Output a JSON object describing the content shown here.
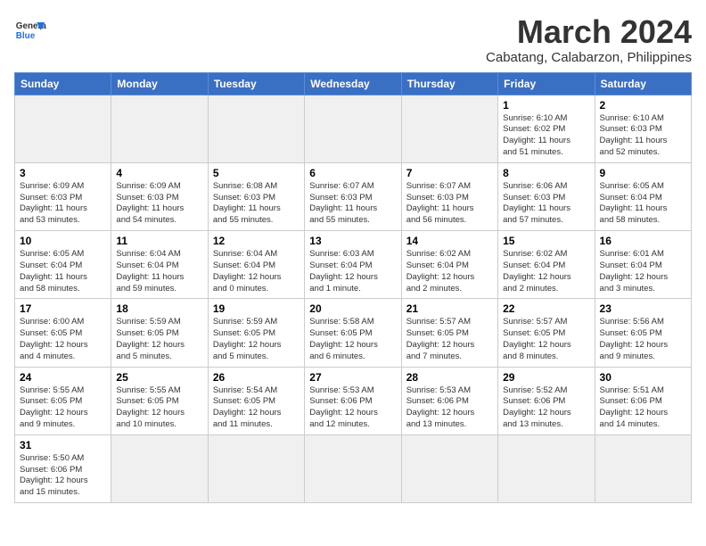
{
  "logo": {
    "general": "General",
    "blue": "Blue"
  },
  "title": "March 2024",
  "subtitle": "Cabatang, Calabarzon, Philippines",
  "days_header": [
    "Sunday",
    "Monday",
    "Tuesday",
    "Wednesday",
    "Thursday",
    "Friday",
    "Saturday"
  ],
  "weeks": [
    [
      {
        "num": "",
        "info": "",
        "empty": true
      },
      {
        "num": "",
        "info": "",
        "empty": true
      },
      {
        "num": "",
        "info": "",
        "empty": true
      },
      {
        "num": "",
        "info": "",
        "empty": true
      },
      {
        "num": "",
        "info": "",
        "empty": true
      },
      {
        "num": "1",
        "info": "Sunrise: 6:10 AM\nSunset: 6:02 PM\nDaylight: 11 hours\nand 51 minutes.",
        "empty": false
      },
      {
        "num": "2",
        "info": "Sunrise: 6:10 AM\nSunset: 6:03 PM\nDaylight: 11 hours\nand 52 minutes.",
        "empty": false
      }
    ],
    [
      {
        "num": "3",
        "info": "Sunrise: 6:09 AM\nSunset: 6:03 PM\nDaylight: 11 hours\nand 53 minutes.",
        "empty": false
      },
      {
        "num": "4",
        "info": "Sunrise: 6:09 AM\nSunset: 6:03 PM\nDaylight: 11 hours\nand 54 minutes.",
        "empty": false
      },
      {
        "num": "5",
        "info": "Sunrise: 6:08 AM\nSunset: 6:03 PM\nDaylight: 11 hours\nand 55 minutes.",
        "empty": false
      },
      {
        "num": "6",
        "info": "Sunrise: 6:07 AM\nSunset: 6:03 PM\nDaylight: 11 hours\nand 55 minutes.",
        "empty": false
      },
      {
        "num": "7",
        "info": "Sunrise: 6:07 AM\nSunset: 6:03 PM\nDaylight: 11 hours\nand 56 minutes.",
        "empty": false
      },
      {
        "num": "8",
        "info": "Sunrise: 6:06 AM\nSunset: 6:03 PM\nDaylight: 11 hours\nand 57 minutes.",
        "empty": false
      },
      {
        "num": "9",
        "info": "Sunrise: 6:05 AM\nSunset: 6:04 PM\nDaylight: 11 hours\nand 58 minutes.",
        "empty": false
      }
    ],
    [
      {
        "num": "10",
        "info": "Sunrise: 6:05 AM\nSunset: 6:04 PM\nDaylight: 11 hours\nand 58 minutes.",
        "empty": false
      },
      {
        "num": "11",
        "info": "Sunrise: 6:04 AM\nSunset: 6:04 PM\nDaylight: 11 hours\nand 59 minutes.",
        "empty": false
      },
      {
        "num": "12",
        "info": "Sunrise: 6:04 AM\nSunset: 6:04 PM\nDaylight: 12 hours\nand 0 minutes.",
        "empty": false
      },
      {
        "num": "13",
        "info": "Sunrise: 6:03 AM\nSunset: 6:04 PM\nDaylight: 12 hours\nand 1 minute.",
        "empty": false
      },
      {
        "num": "14",
        "info": "Sunrise: 6:02 AM\nSunset: 6:04 PM\nDaylight: 12 hours\nand 2 minutes.",
        "empty": false
      },
      {
        "num": "15",
        "info": "Sunrise: 6:02 AM\nSunset: 6:04 PM\nDaylight: 12 hours\nand 2 minutes.",
        "empty": false
      },
      {
        "num": "16",
        "info": "Sunrise: 6:01 AM\nSunset: 6:04 PM\nDaylight: 12 hours\nand 3 minutes.",
        "empty": false
      }
    ],
    [
      {
        "num": "17",
        "info": "Sunrise: 6:00 AM\nSunset: 6:05 PM\nDaylight: 12 hours\nand 4 minutes.",
        "empty": false
      },
      {
        "num": "18",
        "info": "Sunrise: 5:59 AM\nSunset: 6:05 PM\nDaylight: 12 hours\nand 5 minutes.",
        "empty": false
      },
      {
        "num": "19",
        "info": "Sunrise: 5:59 AM\nSunset: 6:05 PM\nDaylight: 12 hours\nand 5 minutes.",
        "empty": false
      },
      {
        "num": "20",
        "info": "Sunrise: 5:58 AM\nSunset: 6:05 PM\nDaylight: 12 hours\nand 6 minutes.",
        "empty": false
      },
      {
        "num": "21",
        "info": "Sunrise: 5:57 AM\nSunset: 6:05 PM\nDaylight: 12 hours\nand 7 minutes.",
        "empty": false
      },
      {
        "num": "22",
        "info": "Sunrise: 5:57 AM\nSunset: 6:05 PM\nDaylight: 12 hours\nand 8 minutes.",
        "empty": false
      },
      {
        "num": "23",
        "info": "Sunrise: 5:56 AM\nSunset: 6:05 PM\nDaylight: 12 hours\nand 9 minutes.",
        "empty": false
      }
    ],
    [
      {
        "num": "24",
        "info": "Sunrise: 5:55 AM\nSunset: 6:05 PM\nDaylight: 12 hours\nand 9 minutes.",
        "empty": false
      },
      {
        "num": "25",
        "info": "Sunrise: 5:55 AM\nSunset: 6:05 PM\nDaylight: 12 hours\nand 10 minutes.",
        "empty": false
      },
      {
        "num": "26",
        "info": "Sunrise: 5:54 AM\nSunset: 6:05 PM\nDaylight: 12 hours\nand 11 minutes.",
        "empty": false
      },
      {
        "num": "27",
        "info": "Sunrise: 5:53 AM\nSunset: 6:06 PM\nDaylight: 12 hours\nand 12 minutes.",
        "empty": false
      },
      {
        "num": "28",
        "info": "Sunrise: 5:53 AM\nSunset: 6:06 PM\nDaylight: 12 hours\nand 13 minutes.",
        "empty": false
      },
      {
        "num": "29",
        "info": "Sunrise: 5:52 AM\nSunset: 6:06 PM\nDaylight: 12 hours\nand 13 minutes.",
        "empty": false
      },
      {
        "num": "30",
        "info": "Sunrise: 5:51 AM\nSunset: 6:06 PM\nDaylight: 12 hours\nand 14 minutes.",
        "empty": false
      }
    ],
    [
      {
        "num": "31",
        "info": "Sunrise: 5:50 AM\nSunset: 6:06 PM\nDaylight: 12 hours\nand 15 minutes.",
        "empty": false
      },
      {
        "num": "",
        "info": "",
        "empty": true
      },
      {
        "num": "",
        "info": "",
        "empty": true
      },
      {
        "num": "",
        "info": "",
        "empty": true
      },
      {
        "num": "",
        "info": "",
        "empty": true
      },
      {
        "num": "",
        "info": "",
        "empty": true
      },
      {
        "num": "",
        "info": "",
        "empty": true
      }
    ]
  ]
}
